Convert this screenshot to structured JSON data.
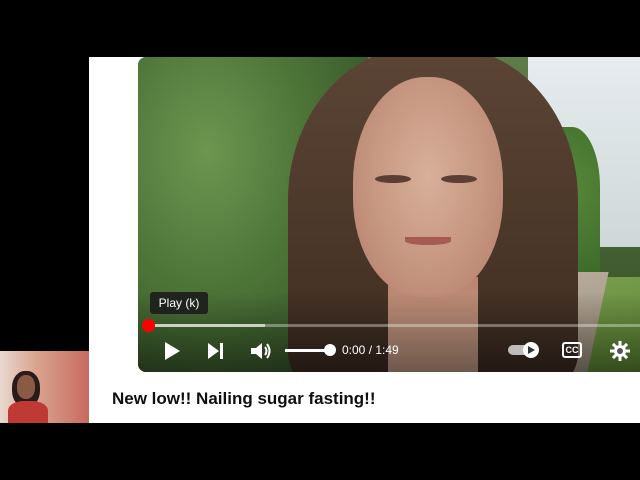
{
  "video": {
    "tooltip": "Play (k)",
    "time_display": "0:00 / 1:49",
    "progress_fraction": 0.0,
    "buffered_fraction": 0.24,
    "volume_fraction": 1.0,
    "autoplay_on": true,
    "controls": {
      "play_icon": "play-icon",
      "next_icon": "next-icon",
      "volume_icon": "volume-icon",
      "autoplay_icon": "autoplay-toggle-icon",
      "cc_label": "CC",
      "settings_icon": "gear-icon"
    }
  },
  "title": "New low!! Nailing sugar fasting!!",
  "colors": {
    "progress_played": "#ff0000",
    "page_bg": "#ffffff",
    "outer_bg": "#000000"
  }
}
